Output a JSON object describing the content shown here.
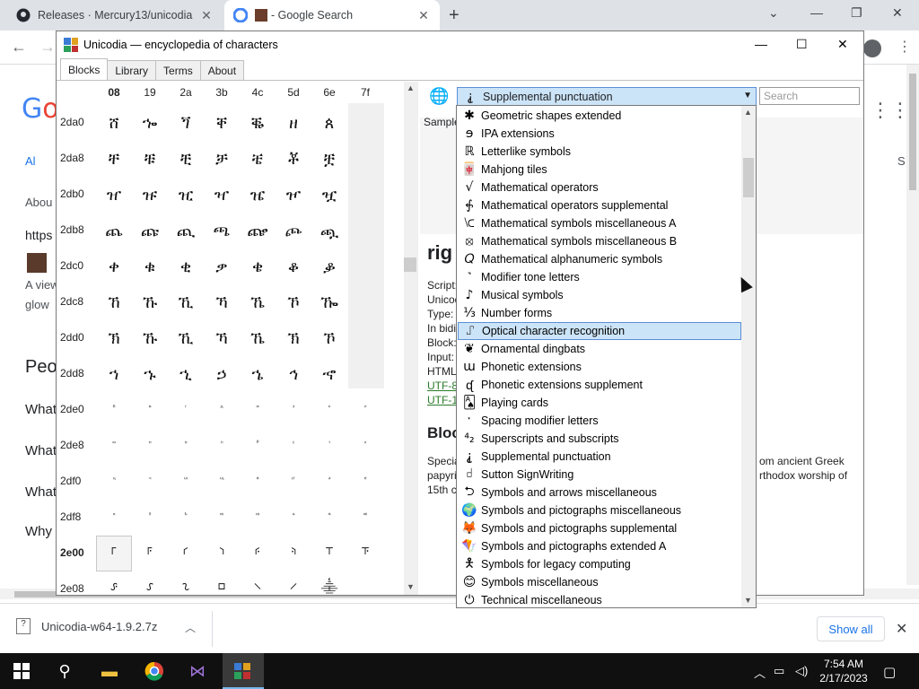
{
  "browser": {
    "tabs": [
      {
        "title": "Releases · Mercury13/unicodia"
      },
      {
        "title": "- Google Search"
      }
    ],
    "newtab": "+",
    "chevron": "⌄",
    "min": "—",
    "restore": "❐",
    "close": "✕",
    "back": "←",
    "forward": "→",
    "kebab": "⋮"
  },
  "google": {
    "logo": "Go",
    "left_texts": [
      "Al",
      "Abou",
      "https",
      "A view",
      "glow",
      "Peo",
      "What",
      "What",
      "What",
      "Why"
    ],
    "right_s": "S",
    "apps": "⋮⋮⋮"
  },
  "unicodia": {
    "title": "Unicodia — encyclopedia of characters",
    "min": "—",
    "max": "☐",
    "close": "✕",
    "tabs": [
      "Blocks",
      "Library",
      "Terms",
      "About"
    ],
    "columns": [
      "08",
      "19",
      "2a",
      "3b",
      "4c",
      "5d",
      "6e",
      "7f"
    ],
    "rows": [
      {
        "label": "2da0",
        "chars": [
          "ሸ",
          "ኈ",
          "ጘ",
          "ቐ",
          "ቘ",
          "ዘ",
          "ጰ",
          ""
        ]
      },
      {
        "label": "2da8",
        "chars": [
          "ቸ",
          "ቹ",
          "ቺ",
          "ቻ",
          "ቼ",
          "ቾ",
          "ቿ",
          ""
        ]
      },
      {
        "label": "2db0",
        "chars": [
          "ዠ",
          "ዡ",
          "ዢ",
          "ዣ",
          "ዤ",
          "ዦ",
          "ዧ",
          ""
        ]
      },
      {
        "label": "2db8",
        "chars": [
          "ጨ",
          "ጩ",
          "ጪ",
          "ጫ",
          "ጬ",
          "ጮ",
          "ጯ",
          ""
        ]
      },
      {
        "label": "2dc0",
        "chars": [
          "ቀ",
          "ቁ",
          "ቂ",
          "ቃ",
          "ቄ",
          "ቆ",
          "ቇ",
          ""
        ]
      },
      {
        "label": "2dc8",
        "chars": [
          "ኸ",
          "ኹ",
          "ኺ",
          "ኻ",
          "ኼ",
          "ኾ",
          "ዀ",
          ""
        ]
      },
      {
        "label": "2dd0",
        "chars": [
          "ኽ",
          "ኹ",
          "ኺ",
          "ኻ",
          "ኼ",
          "ኽ",
          "ኾ",
          ""
        ]
      },
      {
        "label": "2dd8",
        "chars": [
          "ኀ",
          "ኁ",
          "ኂ",
          "ኃ",
          "ኄ",
          "ኅ",
          "ኆ",
          ""
        ]
      },
      {
        "label": "2de0",
        "chars": [
          "ⷠ",
          "ⷡ",
          "ⷢ",
          "ⷣ",
          "ⷤ",
          "ⷥ",
          "ⷦ",
          "ⷧ"
        ]
      },
      {
        "label": "2de8",
        "chars": [
          "ⷨ",
          "ⷩ",
          "ⷪ",
          "ⷫ",
          "ⷬ",
          "ⷭ",
          "ⷮ",
          "ⷯ"
        ]
      },
      {
        "label": "2df0",
        "chars": [
          "ⷰ",
          "ⷱ",
          "ⷲ",
          "ⷳ",
          "ⷴ",
          "ⷵ",
          "ⷶ",
          "ⷷ"
        ]
      },
      {
        "label": "2df8",
        "chars": [
          "ⷸ",
          "ⷹ",
          "ⷺ",
          "ⷻ",
          "ⷼ",
          "ⷽ",
          "ⷾ",
          "ⷿ"
        ]
      },
      {
        "label": "2e00",
        "chars": [
          "⸀",
          "⸁",
          "⸂",
          "⸃",
          "⸄",
          "⸅",
          "⸆",
          "⸇"
        ]
      },
      {
        "label": "2e08",
        "chars": [
          "⸈",
          "⸉",
          "⸊",
          "⸋",
          "⸌",
          "⸍",
          "⸎",
          ""
        ]
      }
    ],
    "combo": {
      "icon": "⸘",
      "value": "Supplemental punctuation"
    },
    "search_placeholder": "Search",
    "sample_label": "Sample",
    "char_title": "rig",
    "info_lines": [
      "Script:",
      "Unicod",
      "Type: P",
      "In bidi",
      "Block:",
      "Input:",
      "HTML:",
      "UTF-8:",
      "UTF-16"
    ],
    "block_heading": "Bloc",
    "desc_lines": [
      "Specia",
      "papyri,",
      "15th c"
    ],
    "desc_right": [
      "om ancient Greek",
      "rthodox worship of"
    ],
    "dropdown": [
      {
        "icon": "✱",
        "label": "Geometric shapes extended"
      },
      {
        "icon": "ɘ",
        "label": "IPA extensions"
      },
      {
        "icon": "ℝ",
        "label": "Letterlike symbols"
      },
      {
        "icon": "🀄",
        "label": "Mahjong tiles"
      },
      {
        "icon": "√",
        "label": "Mathematical operators"
      },
      {
        "icon": "⨗",
        "label": "Mathematical operators supplemental"
      },
      {
        "icon": "⟈",
        "label": "Mathematical symbols miscellaneous A"
      },
      {
        "icon": "⦻",
        "label": "Mathematical symbols miscellaneous B"
      },
      {
        "icon": "𝑄",
        "label": "Mathematical alphanumeric symbols"
      },
      {
        "icon": "˺",
        "label": "Modifier tone letters"
      },
      {
        "icon": "♪",
        "label": "Musical symbols"
      },
      {
        "icon": "⅓",
        "label": "Number forms"
      },
      {
        "icon": "⑀",
        "label": "Optical character recognition"
      },
      {
        "icon": "❦",
        "label": "Ornamental dingbats"
      },
      {
        "icon": "ɯ",
        "label": "Phonetic extensions"
      },
      {
        "icon": "ᶑ",
        "label": "Phonetic extensions supplement"
      },
      {
        "icon": "🂡",
        "label": "Playing cards"
      },
      {
        "icon": "ˑ",
        "label": "Spacing modifier letters"
      },
      {
        "icon": "⁴₂",
        "label": "Superscripts and subscripts"
      },
      {
        "icon": "⸘",
        "label": "Supplemental punctuation"
      },
      {
        "icon": "𝠀",
        "label": "Sutton SignWriting"
      },
      {
        "icon": "⮌",
        "label": "Symbols and arrows miscellaneous"
      },
      {
        "icon": "🌍",
        "label": "Symbols and pictographs miscellaneous"
      },
      {
        "icon": "🦊",
        "label": "Symbols and pictographs supplemental"
      },
      {
        "icon": "🪁",
        "label": "Symbols and pictographs extended A"
      },
      {
        "icon": "🯅",
        "label": "Symbols for legacy computing"
      },
      {
        "icon": "😊",
        "label": "Symbols miscellaneous"
      },
      {
        "icon": "⏻",
        "label": "Technical miscellaneous"
      }
    ],
    "dropdown_highlight_index": 12
  },
  "downloads": {
    "filename": "Unicodia-w64-1.9.2.7z",
    "show_all": "Show all"
  },
  "taskbar": {
    "time": "7:54 AM",
    "date": "2/17/2023"
  }
}
